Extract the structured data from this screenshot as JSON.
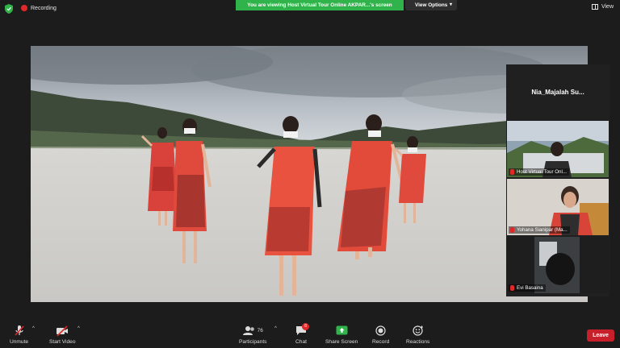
{
  "top_bar": {
    "recording_label": "Recording",
    "share_banner": "You are viewing Host Virtual Tour Online AKPAR...'s screen",
    "view_options_label": "View Options",
    "view_label": "View"
  },
  "panel": {
    "header_name": "Nia_Majalah  Su...",
    "participants": [
      {
        "name": "Host Virtual Tour Onl..."
      },
      {
        "name": "Yohana Sianipar (Ma..."
      },
      {
        "name": "Evi Basaina"
      }
    ]
  },
  "toolbar": {
    "unmute_label": "Unmute",
    "start_video_label": "Start Video",
    "participants_label": "Participants",
    "participants_count": "76",
    "chat_label": "Chat",
    "chat_badge": "8",
    "share_screen_label": "Share Screen",
    "record_label": "Record",
    "reactions_label": "Reactions",
    "leave_label": "Leave"
  },
  "colors": {
    "share_banner_bg": "#2fb34a",
    "leave_bg": "#c8202a",
    "recording_dot": "#e02828",
    "share_screen_icon": "#2fb34a"
  }
}
